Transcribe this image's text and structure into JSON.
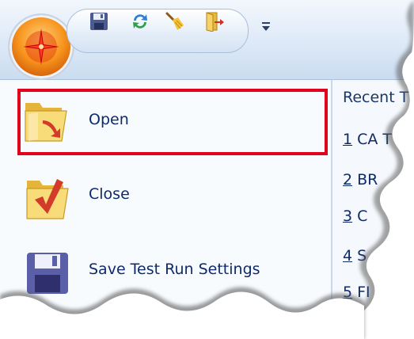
{
  "quick_access_toolbar": {
    "buttons": [
      {
        "icon": "save-icon"
      },
      {
        "icon": "refresh-icon"
      },
      {
        "icon": "broom-icon"
      },
      {
        "icon": "exit-icon"
      }
    ],
    "customize_icon": "chevron-down-icon"
  },
  "application_button": {
    "icon": "star-icon"
  },
  "menu": {
    "items": [
      {
        "label": "Open",
        "icon": "folder-open-icon",
        "highlighted": true
      },
      {
        "label": "Close",
        "icon": "folder-close-icon"
      },
      {
        "label": "Save Test Run Settings",
        "icon": "floppy-disk-icon"
      }
    ]
  },
  "recent": {
    "title": "Recent T",
    "items": [
      {
        "num": "1",
        "text": " CA T"
      },
      {
        "num": "2",
        "text": " BR"
      },
      {
        "num": "3",
        "text": " C"
      },
      {
        "num": "4",
        "text": " S"
      },
      {
        "num": "5",
        "text": " FI"
      }
    ]
  },
  "colors": {
    "highlight_border": "#e0001a",
    "label_text": "#0e2a6a",
    "ribbon_bg": "#dde9f7"
  }
}
